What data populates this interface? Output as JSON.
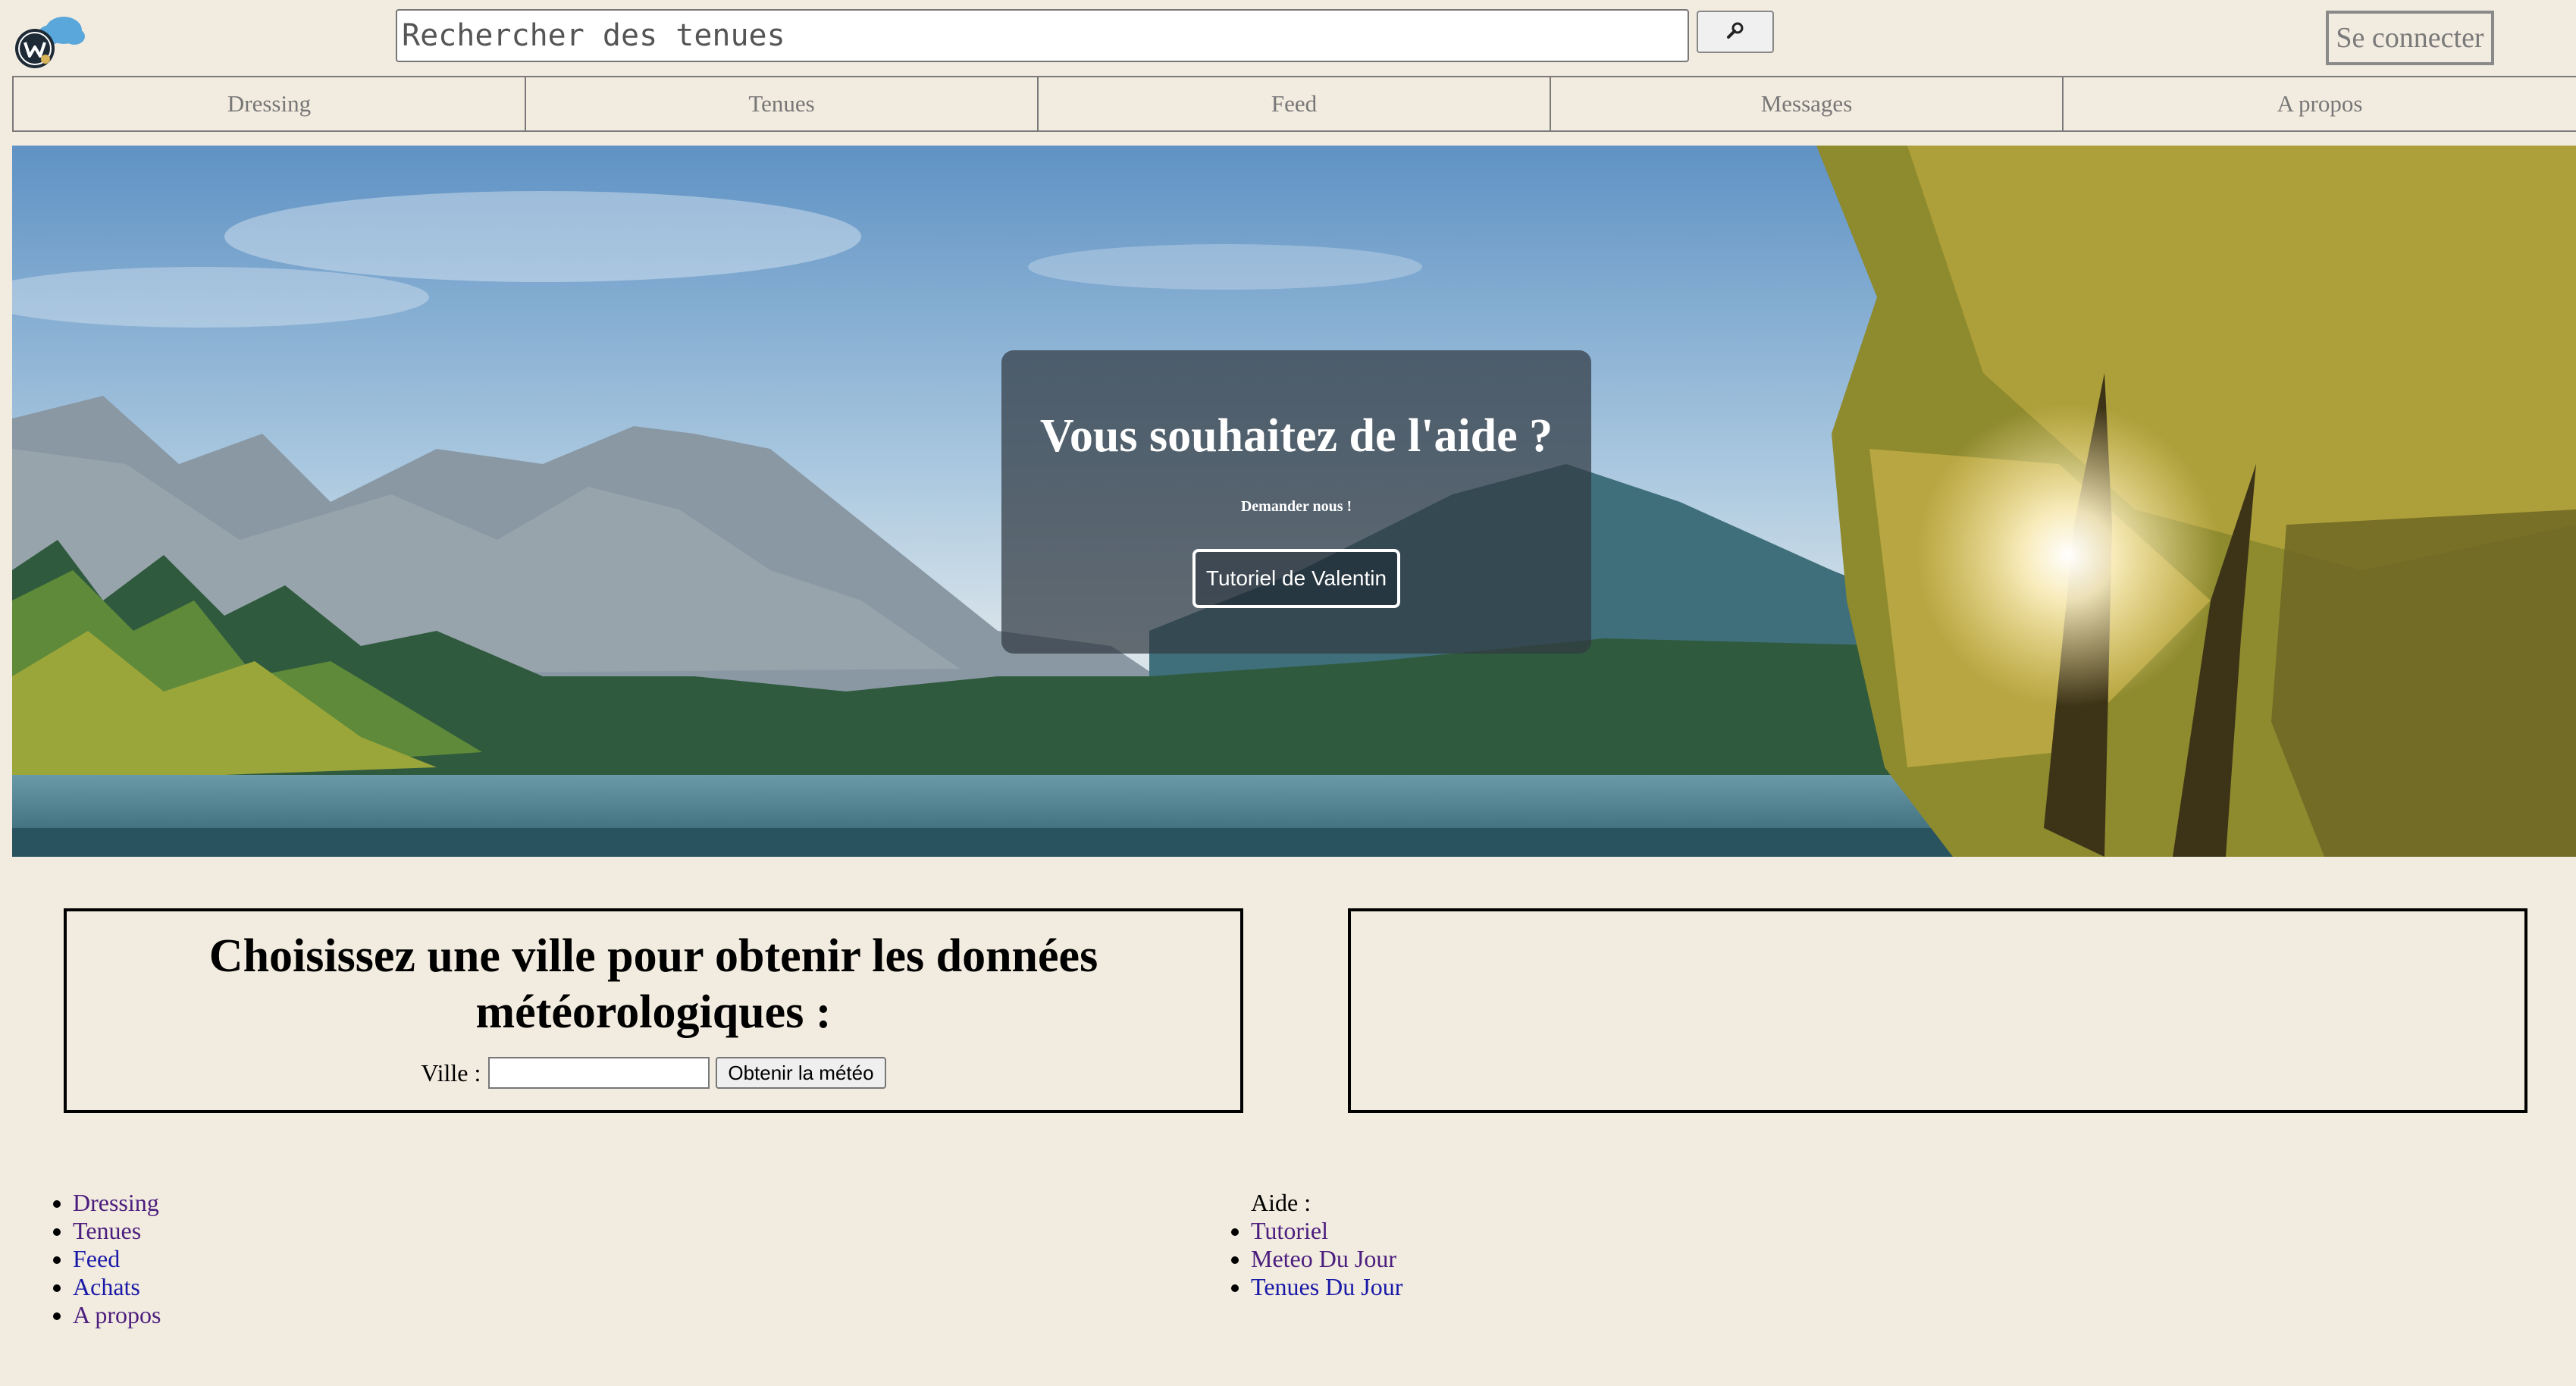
{
  "header": {
    "search_placeholder": "Rechercher des tenues",
    "search_button_icon": "magnifier-icon",
    "login_label": "Se connecter"
  },
  "nav": {
    "items": [
      {
        "label": "Dressing"
      },
      {
        "label": "Tenues"
      },
      {
        "label": "Feed"
      },
      {
        "label": "Messages"
      },
      {
        "label": "A propos"
      }
    ]
  },
  "hero": {
    "title": "Vous souhaitez de l'aide ?",
    "subtitle": "Demander nous !",
    "button_label": "Tutoriel de Valentin"
  },
  "weather": {
    "title": "Choisissez une ville pour obtenir les données météorologiques :",
    "city_label": "Ville :",
    "city_value": "",
    "button_label": "Obtenir la météo"
  },
  "footer": {
    "left_links": [
      {
        "label": "Dressing"
      },
      {
        "label": "Tenues"
      },
      {
        "label": "Feed"
      },
      {
        "label": "Achats"
      },
      {
        "label": "A propos"
      }
    ],
    "help_label": "Aide :",
    "right_links": [
      {
        "label": "Tutoriel"
      },
      {
        "label": "Meteo Du Jour"
      },
      {
        "label": "Tenues Du Jour"
      }
    ]
  },
  "colors": {
    "background": "#f2ebdf",
    "visited_link": "#4b1d7e",
    "link": "#1a1aa8"
  }
}
